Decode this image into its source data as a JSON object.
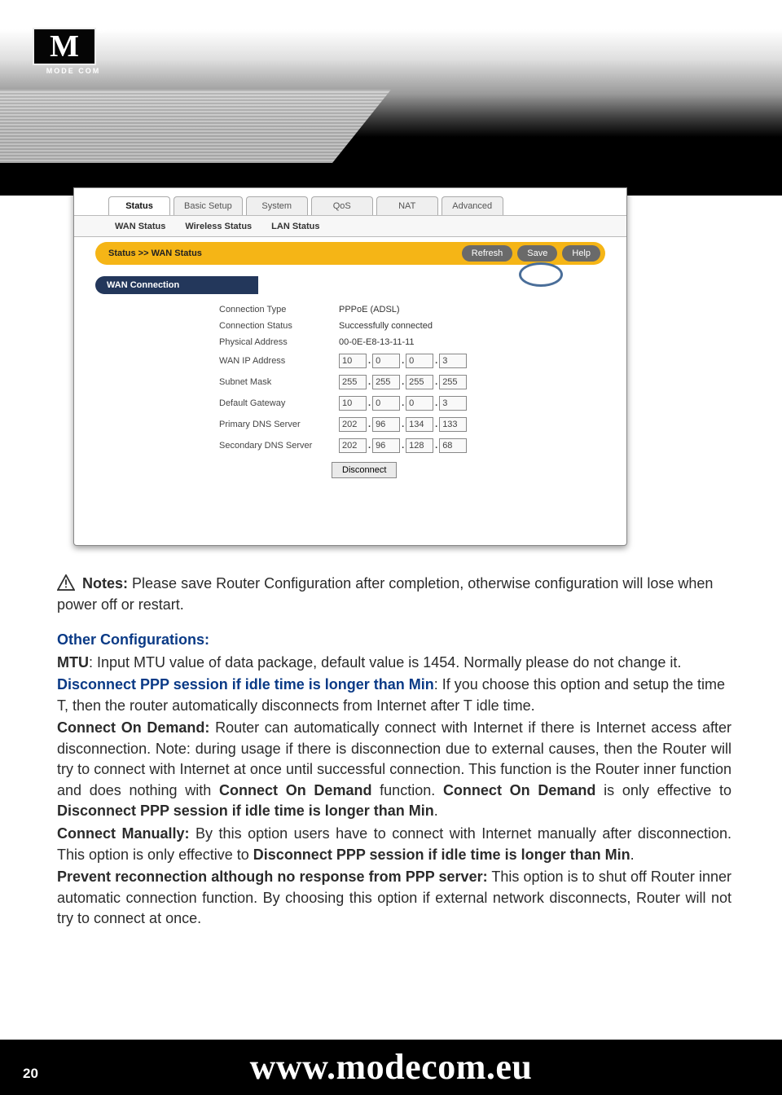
{
  "logo": {
    "letter": "M",
    "reg": "®",
    "name": "MODE COM"
  },
  "screenshot": {
    "mainTabs": [
      {
        "label": "Status",
        "active": true
      },
      {
        "label": "Basic Setup",
        "active": false
      },
      {
        "label": "System",
        "active": false
      },
      {
        "label": "QoS",
        "active": false
      },
      {
        "label": "NAT",
        "active": false
      },
      {
        "label": "Advanced",
        "active": false
      }
    ],
    "subTabs": [
      "WAN Status",
      "Wireless Status",
      "LAN Status"
    ],
    "breadcrumb": "Status >> WAN Status",
    "breadcrumbButtons": [
      "Refresh",
      "Save",
      "Help"
    ],
    "sectionTitle": "WAN Connection",
    "fields": {
      "connType": {
        "label": "Connection Type",
        "value": "PPPoE (ADSL)"
      },
      "connStatus": {
        "label": "Connection Status",
        "value": "Successfully connected"
      },
      "phys": {
        "label": "Physical Address",
        "value": "00-0E-E8-13-11-11"
      },
      "wanIp": {
        "label": "WAN IP Address",
        "ip": [
          "10",
          "0",
          "0",
          "3"
        ]
      },
      "mask": {
        "label": "Subnet Mask",
        "ip": [
          "255",
          "255",
          "255",
          "255"
        ]
      },
      "gw": {
        "label": "Default Gateway",
        "ip": [
          "10",
          "0",
          "0",
          "3"
        ]
      },
      "dns1": {
        "label": "Primary DNS Server",
        "ip": [
          "202",
          "96",
          "134",
          "133"
        ]
      },
      "dns2": {
        "label": "Secondary DNS Server",
        "ip": [
          "202",
          "96",
          "128",
          "68"
        ]
      }
    },
    "disconnect": "Disconnect"
  },
  "body": {
    "notesPrefix": "Notes:",
    "notesText": " Please save Router Configuration after completion, otherwise configuration will lose when power off or restart.",
    "otherHeading": "Other Configurations:",
    "mtuLabel": "MTU",
    "mtuText": ": Input MTU value of data package, default value is 1454. Normally please do not change it.",
    "discLabel": "Disconnect PPP session if idle time is longer than  Min",
    "discText": ": If you choose this option and setup the time T, then the router  automatically disconnects from Internet after T idle time.",
    "codLabel": "Connect On Demand:",
    "codText1": " Router can automatically connect with Internet if there is Internet access after disconnection. Note: during usage if there is disconnection due to external causes, then the Router will try to connect with Internet at once until successful connection. This function is the Router inner function and does nothing with ",
    "codBold1": "Connect On Demand",
    "codText2": " function. ",
    "codBold2": "Connect On Demand",
    "codText3": " is only effective to ",
    "codBold3": "Disconnect PPP session if idle time is longer than  Min",
    "codText4": ".",
    "cmLabel": "Connect Manually:",
    "cmText1": " By this option users have to connect with Internet manually after disconnection. This option is only effective to ",
    "cmBold": "Disconnect PPP session if idle time is longer than Min",
    "cmText2": ".",
    "prLabel": "Prevent reconnection although no response from PPP server:",
    "prText": " This option is to shut off Router inner automatic connection function. By choosing this option if external network disconnects, Router will not try to connect at once."
  },
  "footer": {
    "page": "20",
    "url": "www.modecom.eu"
  }
}
